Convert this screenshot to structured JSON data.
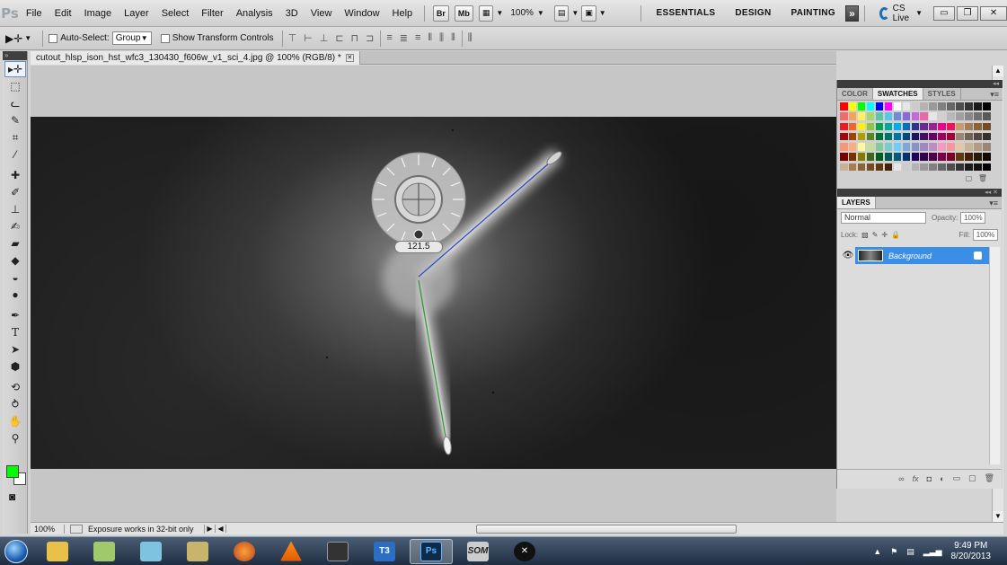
{
  "menubar": {
    "logo": "Ps",
    "items": [
      "File",
      "Edit",
      "Image",
      "Layer",
      "Select",
      "Filter",
      "Analysis",
      "3D",
      "View",
      "Window",
      "Help"
    ],
    "bridge_label": "Br",
    "minibridge_label": "Mb",
    "zoom": "100%",
    "workspaces": [
      "ESSENTIALS",
      "DESIGN",
      "PAINTING"
    ],
    "more_label": "»",
    "cs_live": "CS Live"
  },
  "options": {
    "auto_select_label": "Auto-Select:",
    "auto_select_value": "Group",
    "transform_label": "Show Transform Controls"
  },
  "document": {
    "tab_title": "cutout_hlsp_ison_hst_wfc3_130430_f606w_v1_sci_4.jpg @ 100% (RGB/8) *",
    "rotate_angle": "121.5"
  },
  "status": {
    "zoom": "100%",
    "info": "Exposure works in 32-bit only"
  },
  "panels": {
    "swatch_tabs": [
      "COLOR",
      "SWATCHES",
      "STYLES"
    ],
    "active_swatch_tab": "SWATCHES",
    "layers_tab": "LAYERS",
    "blend_mode": "Normal",
    "opacity_label": "Opacity:",
    "opacity_value": "100%",
    "lock_label": "Lock:",
    "fill_label": "Fill:",
    "fill_value": "100%",
    "layer_name": "Background"
  },
  "colors": {
    "foreground": "#00ff00",
    "background": "#ffffff",
    "layer_selected": "#3a8ee6"
  },
  "taskbar": {
    "apps": [
      "explorer",
      "libraries",
      "notepad",
      "screen",
      "firefox",
      "vlc",
      "media",
      "T3",
      "Ps",
      "SOM",
      "logo"
    ],
    "ps_label": "Ps",
    "t3_label": "T3",
    "som_label": "SOM",
    "time": "9:49 PM",
    "date": "8/20/2013"
  }
}
